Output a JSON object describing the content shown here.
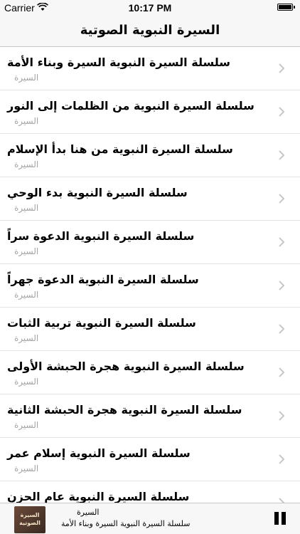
{
  "status_bar": {
    "carrier": "Carrier",
    "time": "10:17 PM",
    "wifi_icon": "wifi-icon",
    "battery_icon": "battery-icon"
  },
  "nav": {
    "title": "السيرة النبوية الصوتية"
  },
  "list": {
    "chevron_icon": "chevron-right-icon",
    "items": [
      {
        "title": "سلسلة السيرة النبوية السيرة وبناء الأمة",
        "subtitle": "السيرة"
      },
      {
        "title": "سلسلة السيرة النبوية من الظلمات إلى النور",
        "subtitle": "السيرة"
      },
      {
        "title": "سلسلة السيرة النبوية من هنا بدأ الإسلام",
        "subtitle": "السيرة"
      },
      {
        "title": "سلسلة السيرة النبوية بدء الوحي",
        "subtitle": "السيرة"
      },
      {
        "title": "سلسلة السيرة النبوية الدعوة سراً",
        "subtitle": "السيرة"
      },
      {
        "title": "سلسلة السيرة النبوية الدعوة جهراً",
        "subtitle": "السيرة"
      },
      {
        "title": "سلسلة السيرة النبوية تربية الثبات",
        "subtitle": "السيرة"
      },
      {
        "title": "سلسلة السيرة النبوية هجرة الحبشة الأولى",
        "subtitle": "السيرة"
      },
      {
        "title": "سلسلة السيرة النبوية هجرة الحبشة الثانية",
        "subtitle": "السيرة"
      },
      {
        "title": "سلسلة السيرة النبوية إسلام عمر",
        "subtitle": "السيرة"
      },
      {
        "title": "سلسلة السيرة النبوية عام الحزن",
        "subtitle": ""
      }
    ]
  },
  "player": {
    "artwork_line1": "السيرة",
    "artwork_line2": "الصوتية",
    "now_playing_title": "السيرة",
    "now_playing_subtitle": "سلسلة السيرة النبوية السيرة وبناء الأمة",
    "pause_icon": "pause-icon"
  }
}
